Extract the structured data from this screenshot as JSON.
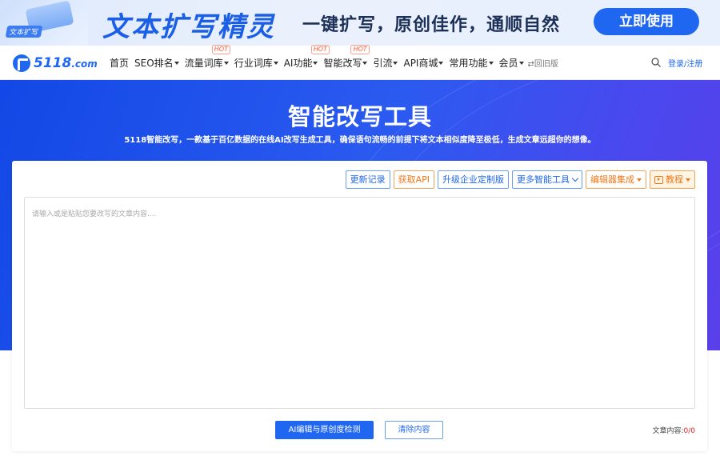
{
  "banner": {
    "badge": "文本扩写",
    "title": "文本扩写精灵",
    "subtitle": "一键扩写，原创佳作，通顺自然",
    "button": "立即使用"
  },
  "nav": {
    "logo_main": "5118",
    "logo_suffix": ".com",
    "items": [
      {
        "label": "首页",
        "dropdown": false,
        "hot": false
      },
      {
        "label": "SEO排名",
        "dropdown": true,
        "hot": false
      },
      {
        "label": "流量词库",
        "dropdown": true,
        "hot": true
      },
      {
        "label": "行业词库",
        "dropdown": true,
        "hot": false
      },
      {
        "label": "AI功能",
        "dropdown": true,
        "hot": true
      },
      {
        "label": "智能改写",
        "dropdown": true,
        "hot": true
      },
      {
        "label": "引流",
        "dropdown": true,
        "hot": false
      },
      {
        "label": "API商城",
        "dropdown": true,
        "hot": false
      },
      {
        "label": "常用功能",
        "dropdown": true,
        "hot": false
      },
      {
        "label": "会员",
        "dropdown": true,
        "hot": false
      }
    ],
    "hot_label": "HOT",
    "old_version": "⇄回旧版",
    "login": "登录/注册"
  },
  "hero": {
    "title": "智能改写工具",
    "description": "5118智能改写，一款基于百亿数据的在线AI改写生成工具，确保语句流畅的前提下将文本相似度降至极低，生成文章远超你的想像。"
  },
  "toolbar": {
    "update_log": "更新记录",
    "get_api": "获取API",
    "enterprise": "升级企业定制版",
    "more_tools": "更多智能工具",
    "editor_integration": "编辑器集成",
    "tutorial": "教程"
  },
  "editor": {
    "placeholder": "请输入或是粘贴您要改写的文章内容....",
    "value": ""
  },
  "actions": {
    "primary": "AI编辑与原创度检测",
    "clear": "清除内容",
    "count_label": "文章内容:",
    "count_value": "0/0"
  },
  "colors": {
    "brand": "#1f66f0",
    "accent_orange": "#f07818",
    "hot_red": "#ff5a3c"
  }
}
